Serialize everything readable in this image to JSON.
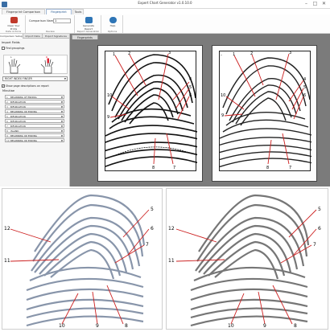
{
  "window": {
    "title": "Expert Chart Generator v1.0.10.0",
    "minimize_glyph": "–",
    "maximize_glyph": "□",
    "close_glyph": "✕"
  },
  "tabs": [
    "Fingerprint Comparison",
    "Fingerprint Search",
    "Tools"
  ],
  "ribbon": {
    "clear_label": "Clear Your Prints",
    "clear_group": "Data Actions",
    "comparison_label": "Comparison Name",
    "comparison_value": "1",
    "review_group": "Review",
    "generate_label": "Generate Report",
    "generate_group": "Report Generation",
    "help_label": "Help",
    "help_group": "Options"
  },
  "panel": {
    "tabs": [
      "Comparison Setup",
      "Import Data",
      "Export Signatures"
    ],
    "import_heading": "Import Fields",
    "find_groups_label": "Find groupings",
    "finger_value": "RIGHT INDEX FINGER",
    "show_labels": "Show page descriptions on report",
    "minutiae_heading": "Minutiae",
    "minutiae": [
      "BEGINNING OF ENDING",
      "BIFURCATION",
      "BIFURCATION",
      "BEGINNING OR ENDING",
      "BIFURCATION",
      "BIFURCATION",
      "BIFURCATION",
      "ISLAND",
      "BEGINNING OR ENDING",
      "BEGINNING OR ENDING"
    ]
  },
  "workspace": {
    "tab_label": "Fingerprints"
  },
  "marker_labels": {
    "left_print": [
      "1",
      "2",
      "3",
      "4",
      "5",
      "6",
      "7",
      "8",
      "9",
      "10"
    ],
    "right_print": [
      "1",
      "2",
      "3",
      "4",
      "5",
      "6",
      "7",
      "8",
      "9",
      "10",
      "-"
    ],
    "zoom_left": [
      "5",
      "6",
      "7",
      "8",
      "9",
      "10",
      "11",
      "12"
    ],
    "zoom_right": [
      "5",
      "6",
      "7",
      "8",
      "9",
      "10",
      "11",
      "12"
    ]
  },
  "colors": {
    "marker_line": "#cc1f1f",
    "accent": "#1a4f8a",
    "workspace_bg": "#7b7b7b"
  }
}
